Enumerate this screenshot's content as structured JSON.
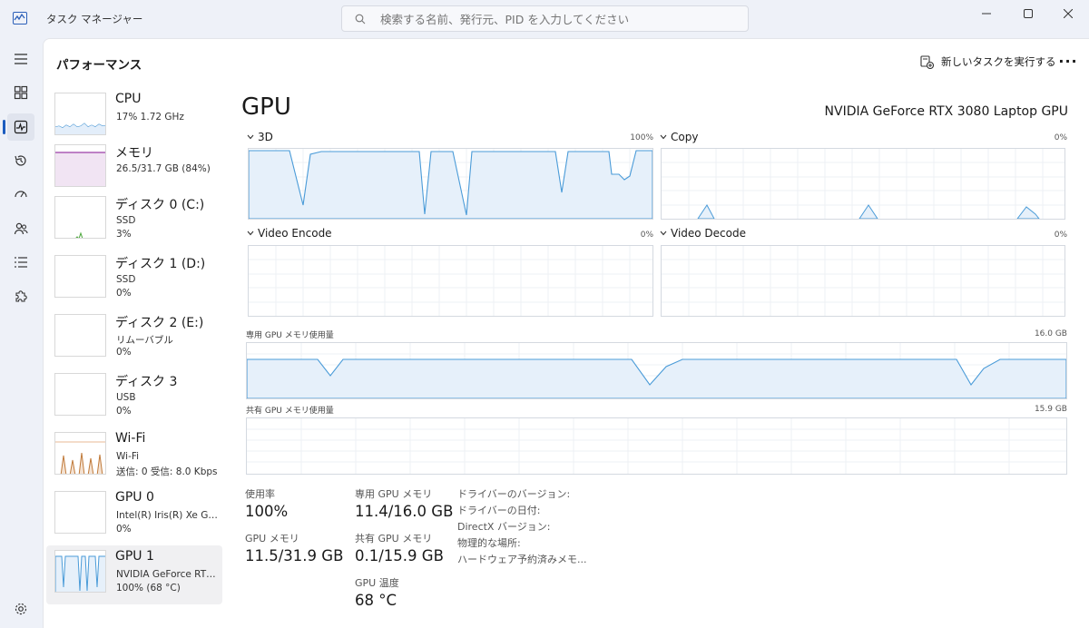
{
  "window": {
    "title": "タスク マネージャー",
    "search_placeholder": "検索する名前、発行元、PID を入力してください"
  },
  "header": {
    "title": "パフォーマンス",
    "run_task_label": "新しいタスクを実行する",
    "more_label": "···"
  },
  "devices": [
    {
      "name": "CPU",
      "line1": "17%  1.72 GHz",
      "line2": ""
    },
    {
      "name": "メモリ",
      "line1": "26.5/31.7 GB (84%)",
      "line2": ""
    },
    {
      "name": "ディスク 0 (C:)",
      "line1": "SSD",
      "line2": "3%"
    },
    {
      "name": "ディスク 1 (D:)",
      "line1": "SSD",
      "line2": "0%"
    },
    {
      "name": "ディスク 2 (E:)",
      "line1": "リムーバブル",
      "line2": "0%"
    },
    {
      "name": "ディスク 3",
      "line1": "USB",
      "line2": "0%"
    },
    {
      "name": "Wi-Fi",
      "line1": "Wi-Fi",
      "line2": "送信: 0 受信: 8.0 Kbps"
    },
    {
      "name": "GPU 0",
      "line1": "Intel(R) Iris(R) Xe Gra...",
      "line2": "0%"
    },
    {
      "name": "GPU 1",
      "line1": "NVIDIA GeForce RTX...",
      "line2": "100% (68 °C)"
    }
  ],
  "gpu": {
    "title": "GPU",
    "model": "NVIDIA GeForce RTX 3080 Laptop GPU",
    "graphs": {
      "3d": {
        "label": "3D",
        "max": "100%"
      },
      "copy": {
        "label": "Copy",
        "max": "0%"
      },
      "video_encode": {
        "label": "Video Encode",
        "max": "0%"
      },
      "video_decode": {
        "label": "Video Decode",
        "max": "0%"
      }
    },
    "dedicated_mem": {
      "label": "専用 GPU メモリ使用量",
      "max": "16.0 GB"
    },
    "shared_mem": {
      "label": "共有 GPU メモリ使用量",
      "max": "15.9 GB"
    },
    "stats": {
      "utilization_label": "使用率",
      "utilization_value": "100%",
      "gpu_mem_label": "GPU メモリ",
      "gpu_mem_value": "11.5/31.9 GB",
      "dedicated_label": "専用 GPU メモリ",
      "dedicated_value": "11.4/16.0 GB",
      "shared_label": "共有 GPU メモリ",
      "shared_value": "0.1/15.9 GB",
      "temp_label": "GPU 温度",
      "temp_value": "68 °C"
    },
    "info": {
      "driver_version": "ドライバーのバージョン:",
      "driver_date": "ドライバーの日付:",
      "directx": "DirectX バージョン:",
      "location": "物理的な場所:",
      "reserved": "ハードウェア予約済みメモ..."
    }
  },
  "colors": {
    "accent": "#1c5cbf",
    "gpu_line": "#4a9bd8",
    "gpu_fill": "#e6f0fa",
    "cpu_line": "#3a8fd0",
    "mem_line": "#9b3ea8",
    "disk_line": "#4aa53a",
    "wifi_line": "#c07a3a"
  }
}
